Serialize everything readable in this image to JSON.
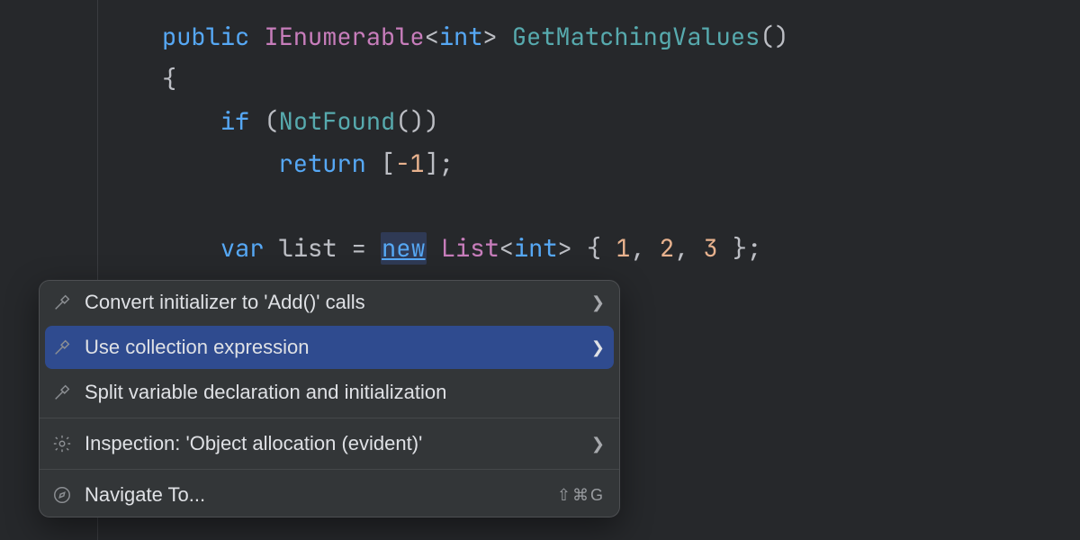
{
  "code": {
    "kw_public": "public",
    "type_ien": "IEnumerable",
    "type_int": "int",
    "fn_name": "GetMatchingValues",
    "brace_open": "{",
    "kw_if": "if",
    "fn_notfound": "NotFound",
    "kw_return": "return",
    "lit_neg1": "-1",
    "kw_var": "var",
    "id_list": "list",
    "op_eq": "=",
    "kw_new": "new",
    "type_list": "List",
    "lit_1": "1",
    "lit_2": "2",
    "lit_3": "3"
  },
  "popup": {
    "items": [
      {
        "label": "Convert initializer to 'Add()' calls",
        "icon": "hammer",
        "has_submenu": true
      },
      {
        "label": "Use collection expression",
        "icon": "hammer",
        "has_submenu": true,
        "selected": true
      },
      {
        "label": "Split variable declaration and initialization",
        "icon": "hammer",
        "has_submenu": false
      },
      {
        "label": "Inspection: 'Object allocation (evident)'",
        "icon": "gear",
        "has_submenu": true
      },
      {
        "label": "Navigate To...",
        "icon": "compass",
        "has_submenu": false,
        "shortcut": "⇧⌘G"
      }
    ]
  }
}
